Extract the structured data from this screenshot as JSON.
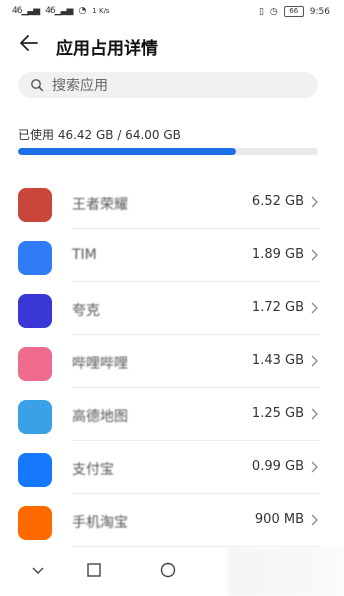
{
  "status_bar": {
    "signal1": "46",
    "signal2": "46",
    "speed": "1 K/s",
    "battery": "66",
    "time": "9:56"
  },
  "header": {
    "title": "应用占用详情"
  },
  "search": {
    "placeholder": "搜索应用"
  },
  "storage": {
    "usage_text": "已使用 46.42 GB / 64.00 GB",
    "used_gb": 46.42,
    "total_gb": 64.0,
    "bar_color": "#1e6ee8"
  },
  "apps": [
    {
      "name": "王者荣耀",
      "size": "6.52 GB",
      "icon_color": "#c9463b",
      "icon": "game-app-icon"
    },
    {
      "name": "TIM",
      "size": "1.89 GB",
      "icon_color": "#2f7cf6",
      "icon": "tim-app-icon"
    },
    {
      "name": "夸克",
      "size": "1.72 GB",
      "icon_color": "#3b37d6",
      "icon": "quark-app-icon"
    },
    {
      "name": "哔哩哔哩",
      "size": "1.43 GB",
      "icon_color": "#f06c8f",
      "icon": "bilibili-app-icon"
    },
    {
      "name": "高德地图",
      "size": "1.25 GB",
      "icon_color": "#3aa0e8",
      "icon": "map-app-icon"
    },
    {
      "name": "支付宝",
      "size": "0.99 GB",
      "icon_color": "#1677ff",
      "icon": "alipay-app-icon"
    },
    {
      "name": "手机淘宝",
      "size": "900 MB",
      "icon_color": "#ff6a00",
      "icon": "taobao-app-icon"
    }
  ]
}
